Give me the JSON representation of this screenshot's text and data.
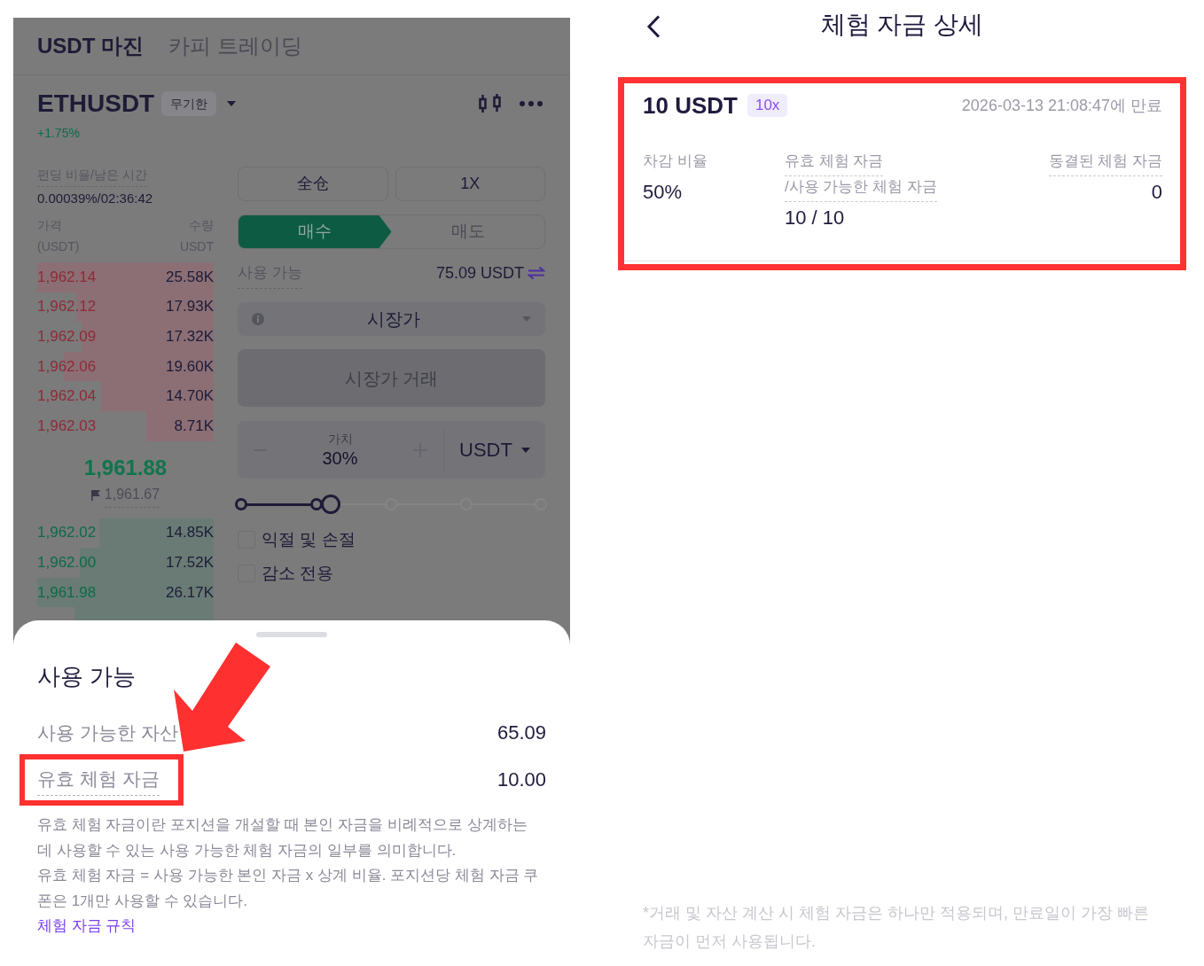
{
  "left_screen": {
    "tabs": [
      {
        "label": "USDT 마진",
        "selected": true
      },
      {
        "label": "카피 트레이딩",
        "selected": false
      }
    ],
    "symbol": {
      "name": "ETHUSDT",
      "badge": "무기한",
      "change": "+1.75%"
    },
    "funding": {
      "label": "펀딩 비율/남은 시간",
      "value": "0.00039%/02:36:42"
    },
    "book_header": {
      "price_label": "가격",
      "price_unit": "(USDT)",
      "qty_label": "수량",
      "qty_unit": "USDT"
    },
    "asks": [
      {
        "price": "1,962.14",
        "qty": "25.58K"
      },
      {
        "price": "1,962.12",
        "qty": "17.93K"
      },
      {
        "price": "1,962.09",
        "qty": "17.32K"
      },
      {
        "price": "1,962.06",
        "qty": "19.60K"
      },
      {
        "price": "1,962.04",
        "qty": "14.70K"
      },
      {
        "price": "1,962.03",
        "qty": "8.71K"
      }
    ],
    "last_price": "1,961.88",
    "mark_price": "1,961.67",
    "bids": [
      {
        "price": "1,962.02",
        "qty": "14.85K"
      },
      {
        "price": "1,962.00",
        "qty": "17.52K"
      },
      {
        "price": "1,961.98",
        "qty": "26.17K"
      }
    ],
    "margin_mode": "全仓",
    "leverage": "1X",
    "sides": [
      {
        "label": "매수",
        "selected": true
      },
      {
        "label": "매도",
        "selected": false
      }
    ],
    "available": {
      "label": "사용 가능",
      "value": "75.09 USDT"
    },
    "order_type": "시장가",
    "submit": "시장가 거래",
    "amount": {
      "label": "가치",
      "value": "30%",
      "unit": "USDT"
    },
    "slider": {
      "level": 0.3
    },
    "options": [
      {
        "label": "익절 및 손절",
        "checked": false
      },
      {
        "label": "감소 전용",
        "checked": false
      }
    ]
  },
  "sheet": {
    "title": "사용 가능",
    "rows": [
      {
        "label": "사용 가능한 자산",
        "value": "65.09",
        "underlined": false,
        "highlighted": false
      },
      {
        "label": "유효 체험 자금",
        "value": "10.00",
        "underlined": true,
        "highlighted": true
      }
    ],
    "description": [
      "유효 체험 자금이란 포지션을 개설할 때 본인 자금을 비례적으로 상계하는 데 사용할 수 있는 사용 가능한 체험 자금의 일부를 의미합니다.",
      "유효 체험 자금 = 사용 가능한 본인 자금 x 상계 비율. 포지션당 체험 자금 쿠폰은 1개만 사용할 수 있습니다."
    ],
    "link": "체험 자금 규칙"
  },
  "right_screen": {
    "title": "체험 자금 상세",
    "card": {
      "highlighted": true,
      "amount": "10 USDT",
      "multiplier": "10x",
      "expiry": "2026-03-13 21:08:47에 만료",
      "stats": [
        {
          "labels": [
            "차감 비율"
          ],
          "value": "50%",
          "underlined": false
        },
        {
          "labels": [
            "유효 체험 자금",
            "/사용 가능한 체험 자금"
          ],
          "value": "10 / 10",
          "underlined": true
        },
        {
          "labels": [
            "동결된 체험 자금"
          ],
          "value": "0",
          "underlined": true
        }
      ]
    },
    "footnote": "*거래 및 자산 계산 시 체험 자금은 하나만 적용되며, 만료일이 가장 빠른 자금이 먼저 사용됩니다."
  }
}
